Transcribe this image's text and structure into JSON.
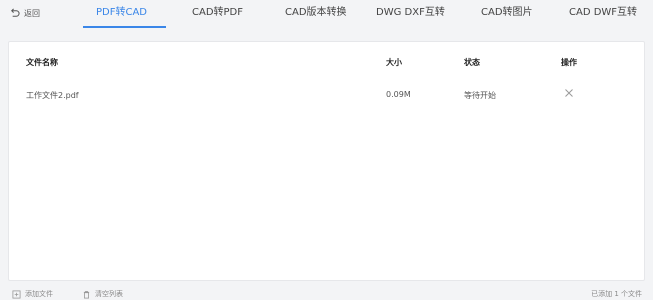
{
  "back": {
    "label": "返回",
    "icon": "back-arrow-icon"
  },
  "tabs": [
    {
      "label": "PDF转CAD",
      "active": true
    },
    {
      "label": "CAD转PDF",
      "active": false
    },
    {
      "label": "CAD版本转换",
      "active": false
    },
    {
      "label": "DWG DXF互转",
      "active": false
    },
    {
      "label": "CAD转图片",
      "active": false
    },
    {
      "label": "CAD DWF互转",
      "active": false
    }
  ],
  "table": {
    "headers": {
      "name": "文件名称",
      "size": "大小",
      "status": "状态",
      "ops": "操作"
    },
    "rows": [
      {
        "name": "工作文件2.pdf",
        "size": "0.09M",
        "status": "等待开始",
        "op_icon": "close-icon"
      }
    ]
  },
  "footer": {
    "add_file": "添加文件",
    "clear_list": "清空列表",
    "count_text": "已添加 1 个文件"
  },
  "colors": {
    "accent": "#3a86e8",
    "background": "#f3f4f6",
    "panel": "#ffffff"
  }
}
